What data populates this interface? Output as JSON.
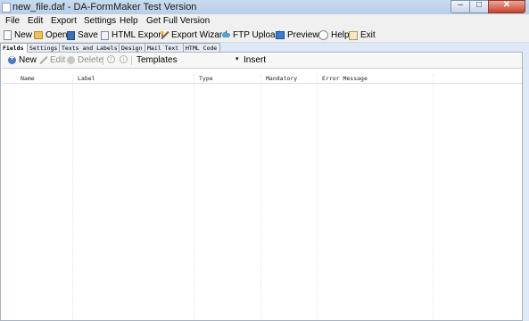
{
  "window": {
    "title": "new_file.daf - DA-FormMaker  Test Version",
    "controls": {
      "minimize": "–",
      "maximize": "□",
      "close": "✕"
    }
  },
  "menu": [
    {
      "label": "File"
    },
    {
      "label": "Edit"
    },
    {
      "label": "Export"
    },
    {
      "label": "Settings"
    },
    {
      "label": "Help"
    },
    {
      "label": "Get Full Version"
    }
  ],
  "toolbar": [
    {
      "label": "New",
      "icon": "new-file-icon"
    },
    {
      "label": "Open",
      "icon": "folder-icon"
    },
    {
      "label": "Save",
      "icon": "save-icon"
    },
    {
      "label": "HTML Export",
      "icon": "html-export-icon"
    },
    {
      "label": "Export Wizard",
      "icon": "wizard-icon"
    },
    {
      "label": "FTP Upload",
      "icon": "ftp-icon"
    },
    {
      "label": "Preview",
      "icon": "preview-icon"
    },
    {
      "label": "Help",
      "icon": "help-icon"
    },
    {
      "label": "Exit",
      "icon": "exit-icon"
    }
  ],
  "tabs": [
    {
      "label": "Fields",
      "active": true
    },
    {
      "label": "Settings"
    },
    {
      "label": "Texts and Labels"
    },
    {
      "label": "Design"
    },
    {
      "label": "Mail Text"
    },
    {
      "label": "HTML Code"
    }
  ],
  "fields_toolbar": {
    "new_label": "New",
    "edit_label": "Edit",
    "delete_label": "Delete",
    "templates_label": "Templates",
    "insert_label": "Insert",
    "dropdown_glyph": "▾",
    "up_glyph": "↑",
    "down_glyph": "↓"
  },
  "grid": {
    "columns": [
      "Name",
      "Label",
      "Type",
      "Mandatory",
      "Error Message"
    ]
  }
}
